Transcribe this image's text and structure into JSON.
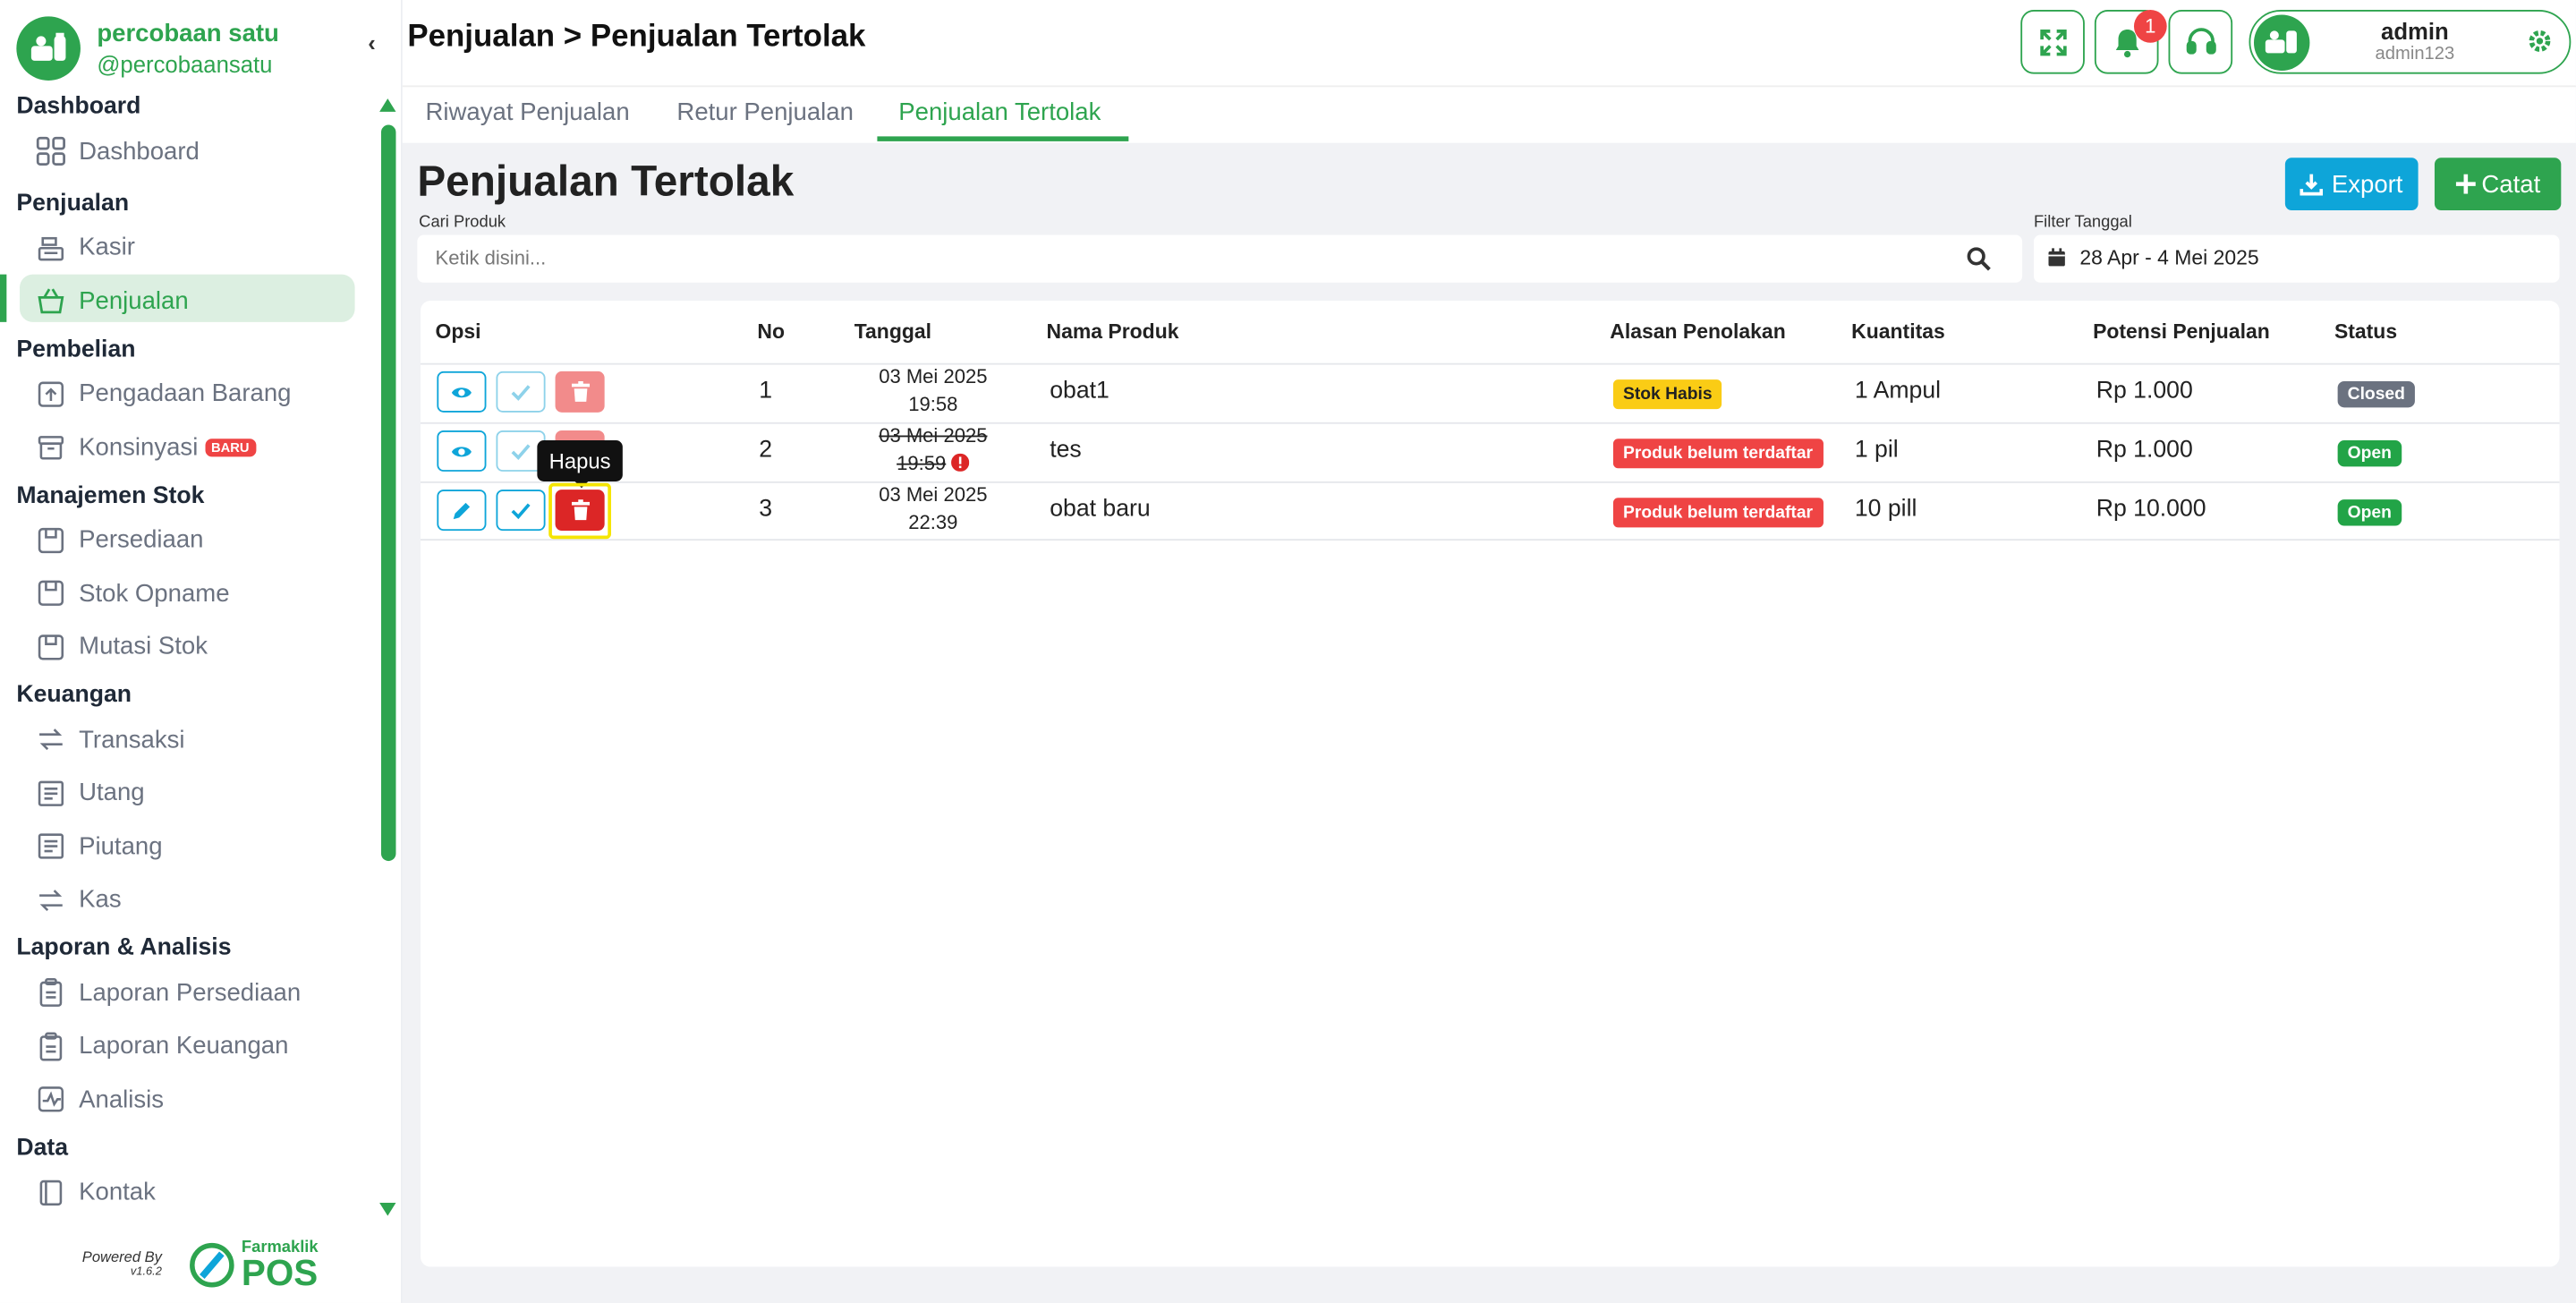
{
  "brand": {
    "name": "percobaan satu",
    "handle": "@percobaansatu"
  },
  "sidebar": {
    "sections": [
      {
        "title": "Dashboard",
        "items": [
          {
            "label": "Dashboard",
            "icon": "grid-icon"
          }
        ]
      },
      {
        "title": "Penjualan",
        "items": [
          {
            "label": "Kasir",
            "icon": "cash-register-icon"
          },
          {
            "label": "Penjualan",
            "icon": "basket-icon",
            "active": true
          }
        ]
      },
      {
        "title": "Pembelian",
        "items": [
          {
            "label": "Pengadaan Barang",
            "icon": "upload-box-icon"
          },
          {
            "label": "Konsinyasi",
            "icon": "archive-icon",
            "badge": "BARU"
          }
        ]
      },
      {
        "title": "Manajemen Stok",
        "items": [
          {
            "label": "Persediaan",
            "icon": "box-icon"
          },
          {
            "label": "Stok Opname",
            "icon": "box-icon"
          },
          {
            "label": "Mutasi Stok",
            "icon": "box-icon"
          }
        ]
      },
      {
        "title": "Keuangan",
        "items": [
          {
            "label": "Transaksi",
            "icon": "exchange-icon"
          },
          {
            "label": "Utang",
            "icon": "receipt-icon"
          },
          {
            "label": "Piutang",
            "icon": "receipt-icon"
          },
          {
            "label": "Kas",
            "icon": "exchange-icon"
          }
        ]
      },
      {
        "title": "Laporan & Analisis",
        "items": [
          {
            "label": "Laporan Persediaan",
            "icon": "clipboard-icon"
          },
          {
            "label": "Laporan Keuangan",
            "icon": "clipboard-icon"
          },
          {
            "label": "Analisis",
            "icon": "chart-icon"
          }
        ]
      },
      {
        "title": "Data",
        "items": [
          {
            "label": "Kontak",
            "icon": "contact-book-icon"
          }
        ]
      }
    ]
  },
  "footer": {
    "powered": "Powered By",
    "version": "v1.6.2",
    "logo_top": "Farmaklik",
    "logo_bottom": "POS"
  },
  "header": {
    "breadcrumb": "Penjualan > Penjualan Tertolak",
    "notif_count": "1",
    "user_name": "admin",
    "user_handle": "admin123"
  },
  "tabs": [
    "Riwayat Penjualan",
    "Retur Penjualan",
    "Penjualan Tertolak"
  ],
  "page": {
    "title": "Penjualan Tertolak",
    "export_label": "Export",
    "catat_label": "Catat",
    "search_label": "Cari Produk",
    "search_placeholder": "Ketik disini...",
    "filter_label": "Filter Tanggal",
    "filter_value": "28 Apr - 4 Mei 2025"
  },
  "table": {
    "headers": [
      "Opsi",
      "No",
      "Tanggal",
      "Nama Produk",
      "Alasan Penolakan",
      "Kuantitas",
      "Potensi Penjualan",
      "Status"
    ],
    "rows": [
      {
        "no": "1",
        "date": "03 Mei 2025",
        "time": "19:58",
        "product": "obat1",
        "reason": "Stok Habis",
        "qty": "1 Ampul",
        "potential": "Rp 1.000",
        "status": "Closed"
      },
      {
        "no": "2",
        "date": "03 Mei 2025",
        "time": "19:59",
        "product": "tes",
        "reason": "Produk belum terdaftar",
        "qty": "1 pil",
        "potential": "Rp 1.000",
        "status": "Open"
      },
      {
        "no": "3",
        "date": "03 Mei 2025",
        "time": "22:39",
        "product": "obat baru",
        "reason": "Produk belum terdaftar",
        "qty": "10 pill",
        "potential": "Rp 10.000",
        "status": "Open"
      }
    ]
  },
  "tooltip": "Hapus",
  "colors": {
    "primary": "#2ea44f",
    "info": "#0ea5d9",
    "danger": "#ef4444",
    "warning": "#facc15"
  }
}
